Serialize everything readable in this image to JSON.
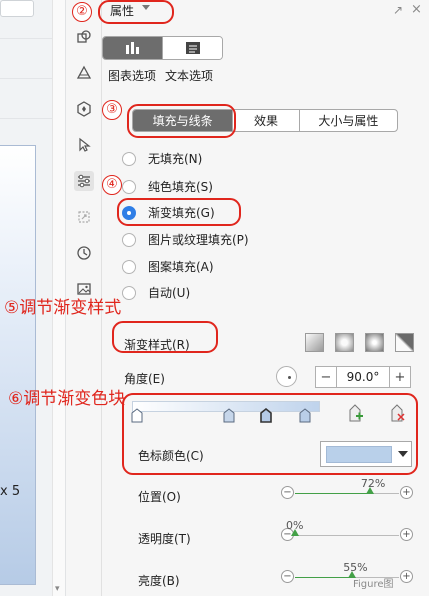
{
  "canvas": {
    "shape_label": "x 5"
  },
  "panel": {
    "title": "属性",
    "mode_tabs": [
      {
        "icon": "chart-options-icon",
        "active": true
      },
      {
        "icon": "text-options-icon",
        "active": false
      }
    ],
    "mode_labels": [
      "图表选项",
      "文本选项"
    ],
    "tabs": [
      {
        "label": "填充与线条",
        "active": true
      },
      {
        "label": "效果",
        "active": false
      },
      {
        "label": "大小与属性",
        "active": false
      }
    ],
    "fill_options": [
      {
        "label": "无填充(N)",
        "selected": false
      },
      {
        "label": "纯色填充(S)",
        "selected": false
      },
      {
        "label": "渐变填充(G)",
        "selected": true
      },
      {
        "label": "图片或纹理填充(P)",
        "selected": false
      },
      {
        "label": "图案填充(A)",
        "selected": false
      },
      {
        "label": "自动(U)",
        "selected": false
      }
    ],
    "gradient_style_label": "渐变样式(R)",
    "angle_label": "角度(E)",
    "angle_value": "90.0°",
    "stepper_minus": "−",
    "stepper_plus": "+",
    "color_label": "色标颜色(C)",
    "color_value": "#b9d0ea",
    "sliders": [
      {
        "label": "位置(O)",
        "value": "72%",
        "fraction": 0.72
      },
      {
        "label": "透明度(T)",
        "value": "0%",
        "fraction": 0.0
      },
      {
        "label": "亮度(B)",
        "value": "55%",
        "fraction": 0.55
      }
    ]
  },
  "annotations": {
    "num2": "②",
    "num3": "③",
    "num4": "④",
    "step5": "⑤调节渐变样式",
    "step6": "⑥调节渐变色块"
  },
  "watermark": "Figure图"
}
